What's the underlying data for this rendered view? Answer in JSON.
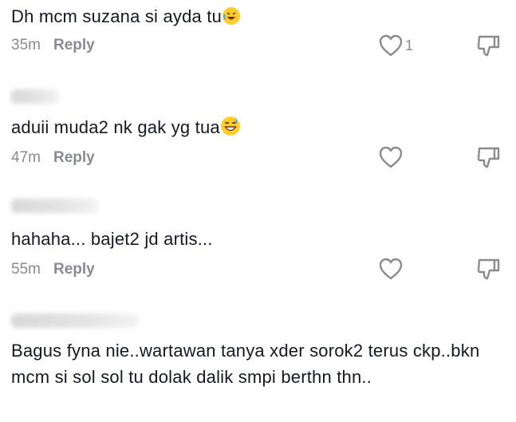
{
  "comments": [
    {
      "text": "Dh mcm suzana si ayda tu",
      "emoji": "🤣",
      "time": "35m",
      "reply": "Reply",
      "likes": "1"
    },
    {
      "text": "aduii muda2 nk gak yg tua",
      "emoji": "😅",
      "time": "47m",
      "reply": "Reply",
      "likes": ""
    },
    {
      "text": "hahaha... bajet2 jd artis...",
      "emoji": "",
      "time": "55m",
      "reply": "Reply",
      "likes": ""
    },
    {
      "text": "Bagus fyna nie..wartawan tanya xder sorok2 terus ckp..bkn mcm si sol sol tu dolak dalik smpi berthn thn..",
      "emoji": "",
      "time": "",
      "reply": "",
      "likes": ""
    }
  ],
  "colors": {
    "text": "#161823",
    "muted": "#8a8b91"
  },
  "icons": [
    "heart-outline-icon",
    "thumbs-down-icon",
    "rolling-laughing-emoji",
    "sweat-smile-emoji"
  ]
}
